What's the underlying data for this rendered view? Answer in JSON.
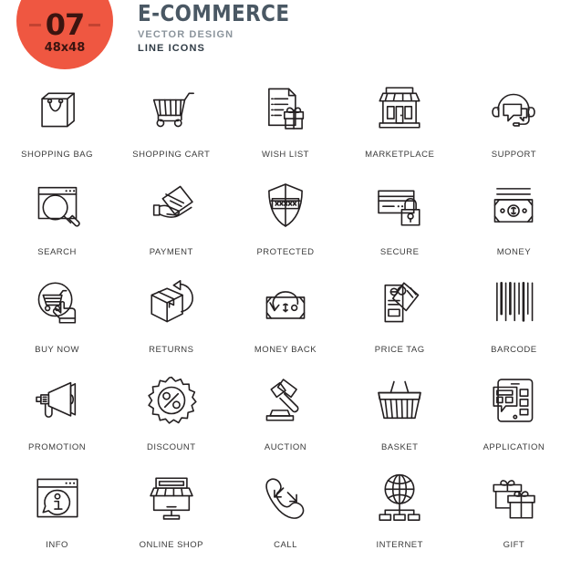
{
  "header": {
    "badge_number": "07",
    "badge_size": "48x48",
    "title": "E-COMMERCE",
    "subtitle_1": "VECTOR DESIGN",
    "subtitle_2": "LINE ICONS",
    "badge_color": "#ef5741",
    "badge_text_color": "#3b1410",
    "title_color": "#4a5864",
    "subtitle_1_color": "#8b949c",
    "subtitle_2_color": "#2f3b45"
  },
  "grid": {
    "columns": 5,
    "rows": 5,
    "stroke_color": "#231f20",
    "label_color": "#3b3b3b",
    "icons": [
      {
        "label": "SHOPPING BAG",
        "icon": "shopping-bag-icon"
      },
      {
        "label": "SHOPPING CART",
        "icon": "shopping-cart-icon"
      },
      {
        "label": "WISH LIST",
        "icon": "wish-list-icon"
      },
      {
        "label": "MARKETPLACE",
        "icon": "marketplace-icon"
      },
      {
        "label": "SUPPORT",
        "icon": "support-headset-icon"
      },
      {
        "label": "SEARCH",
        "icon": "search-browser-icon"
      },
      {
        "label": "PAYMENT",
        "icon": "payment-hand-cards-icon"
      },
      {
        "label": "PROTECTED",
        "icon": "protected-shield-password-icon"
      },
      {
        "label": "SECURE",
        "icon": "secure-card-lock-icon"
      },
      {
        "label": "MONEY",
        "icon": "money-banknotes-icon"
      },
      {
        "label": "BUY NOW",
        "icon": "buy-now-hand-cart-icon"
      },
      {
        "label": "RETURNS",
        "icon": "returns-box-arrow-icon"
      },
      {
        "label": "MONEY BACK",
        "icon": "money-back-icon"
      },
      {
        "label": "PRICE TAG",
        "icon": "price-tag-icon"
      },
      {
        "label": "BARCODE",
        "icon": "barcode-icon"
      },
      {
        "label": "PROMOTION",
        "icon": "promotion-megaphone-icon"
      },
      {
        "label": "DISCOUNT",
        "icon": "discount-percent-badge-icon"
      },
      {
        "label": "AUCTION",
        "icon": "auction-gavel-icon"
      },
      {
        "label": "BASKET",
        "icon": "basket-icon"
      },
      {
        "label": "APPLICATION",
        "icon": "application-phone-icon"
      },
      {
        "label": "INFO",
        "icon": "info-browser-icon"
      },
      {
        "label": "ONLINE SHOP",
        "icon": "online-shop-monitor-icon"
      },
      {
        "label": "CALL",
        "icon": "call-handset-arrows-icon"
      },
      {
        "label": "INTERNET",
        "icon": "internet-globe-network-icon"
      },
      {
        "label": "GIFT",
        "icon": "gift-boxes-icon"
      }
    ]
  }
}
